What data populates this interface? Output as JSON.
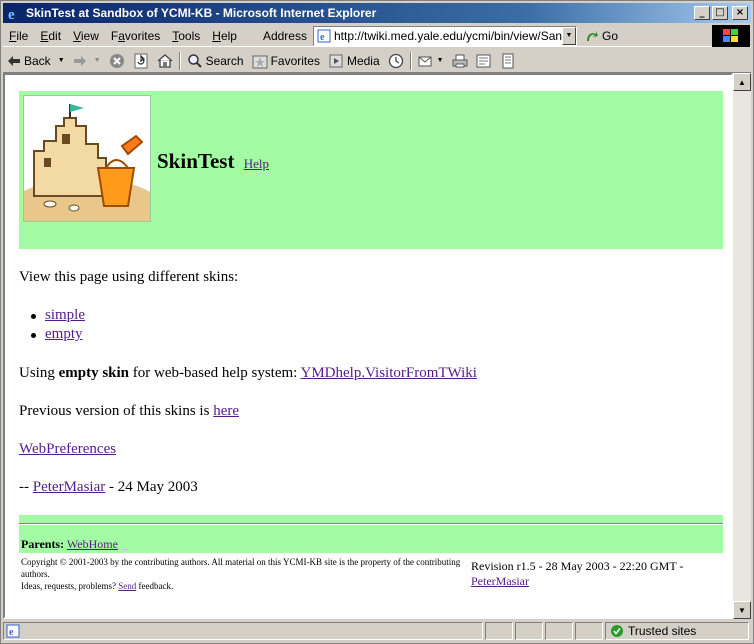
{
  "window": {
    "title": "SkinTest at Sandbox of YCMI-KB - Microsoft Internet Explorer",
    "minimize": "_",
    "maximize": "□",
    "close": "×"
  },
  "menu": [
    "File",
    "Edit",
    "View",
    "Favorites",
    "Tools",
    "Help"
  ],
  "menu_access_keys": [
    "F",
    "E",
    "V",
    "a",
    "T",
    "H"
  ],
  "address": {
    "label": "Address",
    "url": "http://twiki.med.yale.edu/ycmi/bin/view/Sandbox/SkinTest",
    "go_label": "Go"
  },
  "toolbar": {
    "back": "Back",
    "search": "Search",
    "favorites": "Favorites",
    "media": "Media"
  },
  "page": {
    "title": "SkinTest",
    "help_link": "Help",
    "intro": "View this page using different skins:",
    "skins": [
      "simple",
      "empty"
    ],
    "using_prefix": "Using ",
    "using_bold": "empty skin",
    "using_middle": " for web-based help system: ",
    "using_link": "YMDhelp.VisitorFromTWiki",
    "previous_prefix": "Previous version of this skins is ",
    "previous_link": "here",
    "web_prefs_link": "WebPreferences",
    "signature_prefix": "-- ",
    "signature_link": "PeterMasiar",
    "signature_date": " - 24 May 2003"
  },
  "footer": {
    "parents_label": "Parents:",
    "parents_link": "WebHome",
    "copyright_line1": "Copyright © 2001-2003 by the contributing authors. All material on this YCMI-KB site is the property of the contributing authors.",
    "copyright_line2_prefix": "Ideas, requests, problems? ",
    "copyright_send": "Send",
    "copyright_line2_suffix": " feedback.",
    "revision_text": "Revision r1.5 - 28 May 2003 - 22:20 GMT - ",
    "revision_author": "PeterMasiar"
  },
  "status": {
    "zone": "Trusted sites"
  },
  "colors": {
    "band": "#a3fba3",
    "link": "#551a8b",
    "titlebar": "#0a246a"
  }
}
